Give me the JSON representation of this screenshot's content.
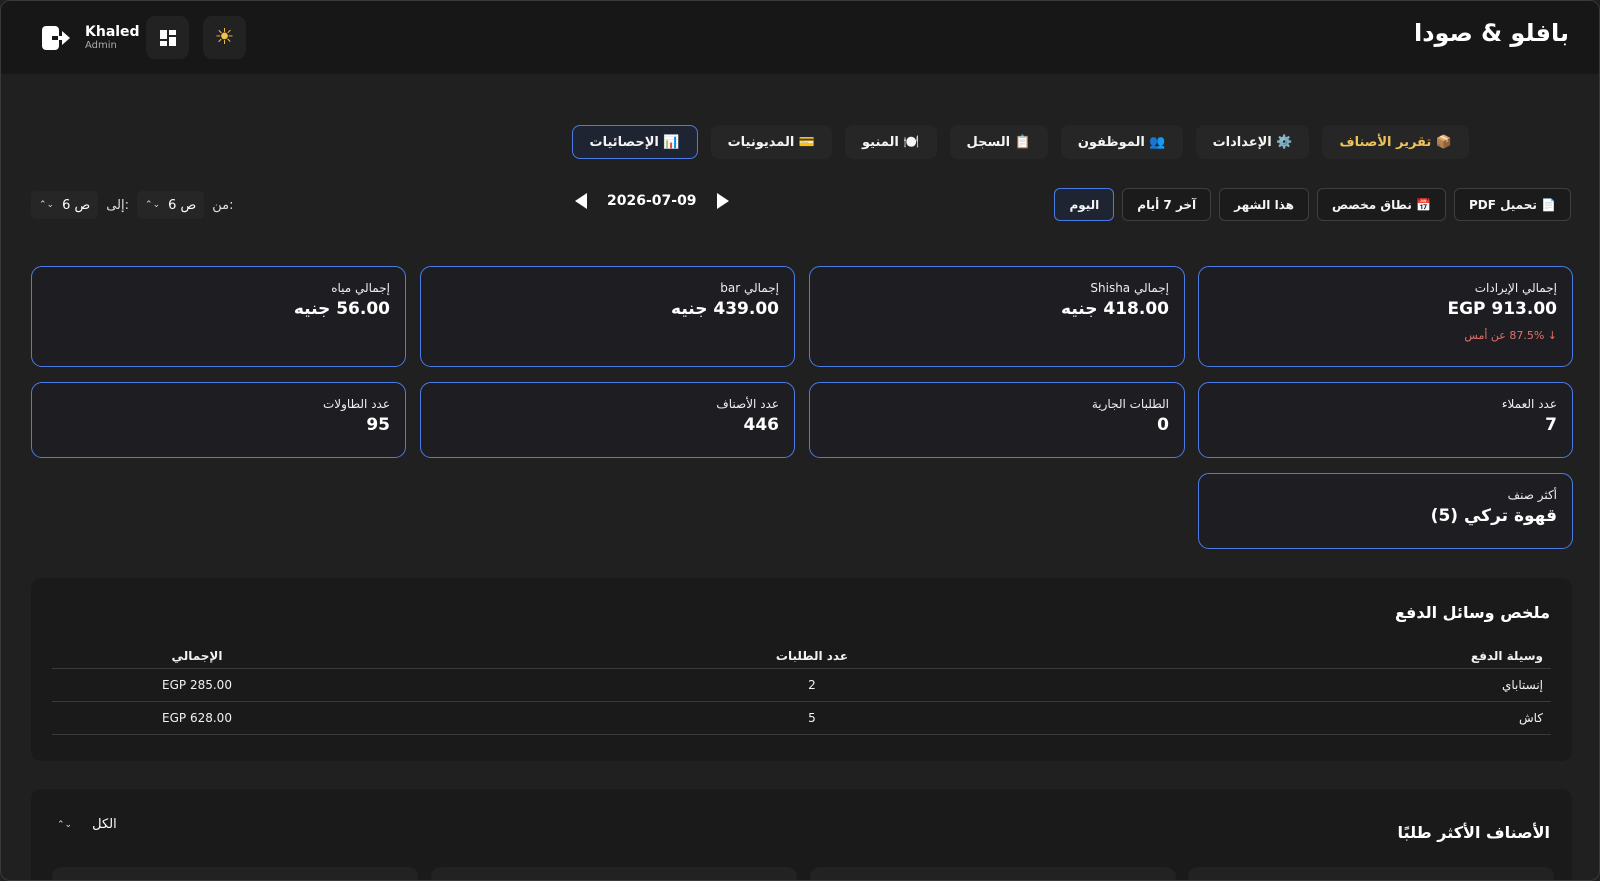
{
  "header": {
    "brand": "بافلو & صودا",
    "user_name": "Khaled",
    "user_role": "Admin",
    "icons": [
      "logout-icon",
      "dashboard-grid-icon",
      "sun-icon"
    ]
  },
  "tabs": [
    {
      "label": "📊 الإحصائيات",
      "active": true
    },
    {
      "label": "💳 المديونيات"
    },
    {
      "label": "🍽️ المنيو"
    },
    {
      "label": "📋 السجل"
    },
    {
      "label": "👥 الموظفون"
    },
    {
      "label": "⚙️ الإعدادات"
    },
    {
      "label": "📦 تقرير الأصناف",
      "highlight": "#f0c35a"
    }
  ],
  "filters": {
    "today": "اليوم",
    "last7": "آخر 7 أيام",
    "month": "هذا الشهر",
    "custom": "📅 نطاق مخصص",
    "pdf": "📄 تحميل PDF"
  },
  "date": "2026-07-09",
  "time_range": {
    "from_label": "من:",
    "from_value": "6 ص",
    "to_label": "إلى:",
    "to_value": "6 ص"
  },
  "stats": {
    "revenue_title": "إجمالي الإيرادات",
    "revenue_value": "EGP 913.00",
    "revenue_delta": "↓ 87.5% عن أمس",
    "shisha_title": "إجمالي Shisha",
    "shisha_value": "418.00 جنيه",
    "bar_title": "إجمالي bar",
    "bar_value": "439.00 جنيه",
    "water_title": "إجمالي مياه",
    "water_value": "56.00 جنيه",
    "customers_title": "عدد العملاء",
    "customers_value": "7",
    "running_title": "الطلبات الجارية",
    "running_value": "0",
    "items_title": "عدد الأصناف",
    "items_value": "446",
    "tables_title": "عدد الطاولات",
    "tables_value": "95",
    "top_title": "أكثر صنف",
    "top_value": "قهوة تركي (5)"
  },
  "payments": {
    "title": "ملخص وسائل الدفع",
    "columns": [
      "وسيلة الدفع",
      "عدد الطلبات",
      "الإجمالي"
    ],
    "rows": [
      {
        "method": "إنستاباي",
        "count": "2",
        "total": "EGP 285.00"
      },
      {
        "method": "كاش",
        "count": "5",
        "total": "EGP 628.00"
      }
    ]
  },
  "top_items": {
    "title": "الأصناف الأكثر طلبًا",
    "filter_value": "الكل"
  },
  "colors": {
    "accent": "#4b7be5",
    "negative": "#e0716a",
    "gold": "#f0c35a"
  }
}
